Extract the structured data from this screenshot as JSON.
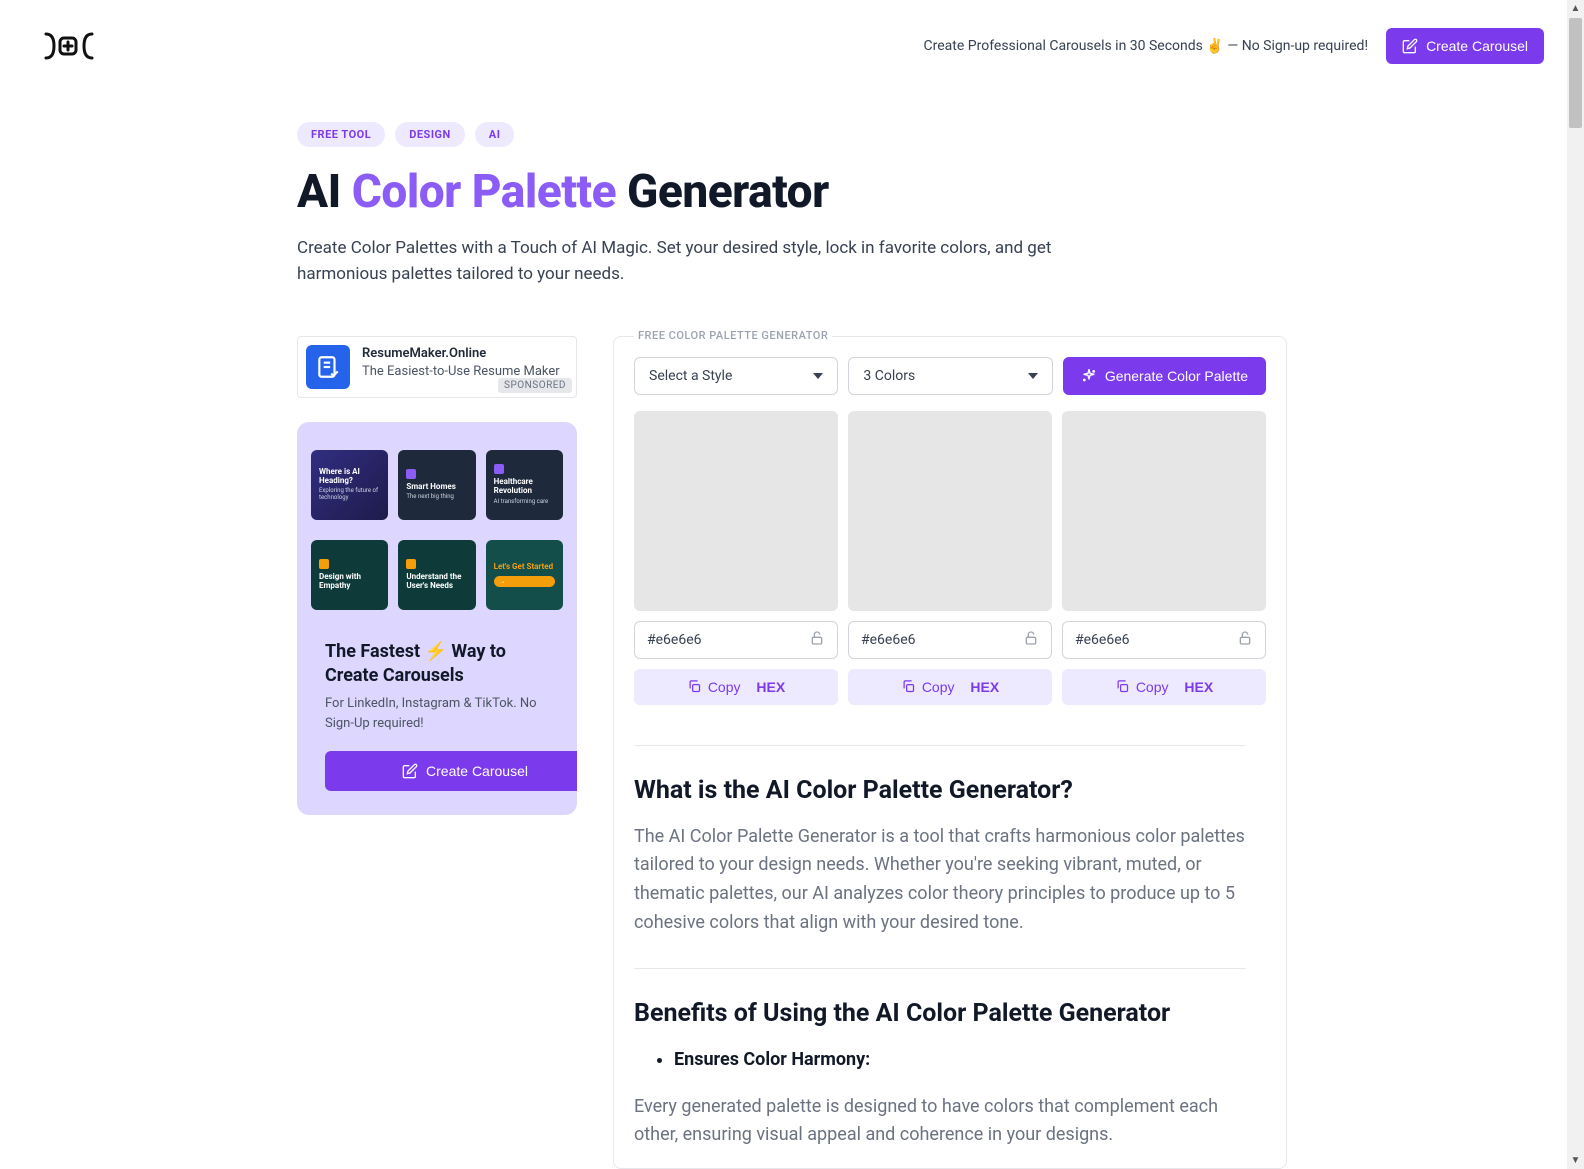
{
  "header": {
    "tagline": "Create Professional Carousels in 30 Seconds",
    "tagline_emoji": "✌️",
    "tagline_suffix": " — No Sign-up required!",
    "cta": "Create Carousel"
  },
  "tags": [
    "FREE TOOL",
    "DESIGN",
    "AI"
  ],
  "title_pre": "AI ",
  "title_accent": "Color Palette",
  "title_post": " Generator",
  "subtitle": "Create Color Palettes with a Touch of AI Magic. Set your desired style, lock in favorite colors, and get harmonious palettes tailored to your needs.",
  "sponsored": {
    "title": "ResumeMaker.Online",
    "sub": "The Easiest-to-Use Resume Maker",
    "label": "SPONSORED"
  },
  "promo": {
    "heading_pre": "The Fastest ",
    "heading_emoji": "⚡",
    "heading_post": " Way to Create Carousels",
    "sub": "For LinkedIn, Instagram & TikTok. No Sign-Up required!",
    "cta": "Create Carousel",
    "slides_a": [
      {
        "t1": "Where is AI Heading?",
        "t2": "Exploring the future of technology"
      },
      {
        "t1": "Smart Homes",
        "t2": "The next big thing"
      },
      {
        "t1": "Healthcare Revolution",
        "t2": "AI transforming care"
      }
    ],
    "slides_b": [
      {
        "t1": "Design with Empathy",
        "t2": ""
      },
      {
        "t1": "Understand the User's Needs",
        "t2": ""
      },
      {
        "t1": "Let's Get Started",
        "t2": ""
      }
    ]
  },
  "generator": {
    "legend": "FREE COLOR PALETTE GENERATOR",
    "style_placeholder": "Select a Style",
    "count_value": "3 Colors",
    "generate_label": "Generate Color Palette",
    "copy_label": "Copy",
    "hex_label": "HEX",
    "swatches": [
      {
        "hex": "#e6e6e6"
      },
      {
        "hex": "#e6e6e6"
      },
      {
        "hex": "#e6e6e6"
      }
    ]
  },
  "article": {
    "h1": "What is the AI Color Palette Generator?",
    "p1": "The AI Color Palette Generator is a tool that crafts harmonious color palettes tailored to your design needs. Whether you're seeking vibrant, muted, or thematic palettes, our AI analyzes color theory principles to produce up to 5 cohesive colors that align with your desired tone.",
    "h2": "Benefits of Using the AI Color Palette Generator",
    "li1": "Ensures Color Harmony:",
    "p2": "Every generated palette is designed to have colors that complement each other, ensuring visual appeal and coherence in your designs."
  }
}
